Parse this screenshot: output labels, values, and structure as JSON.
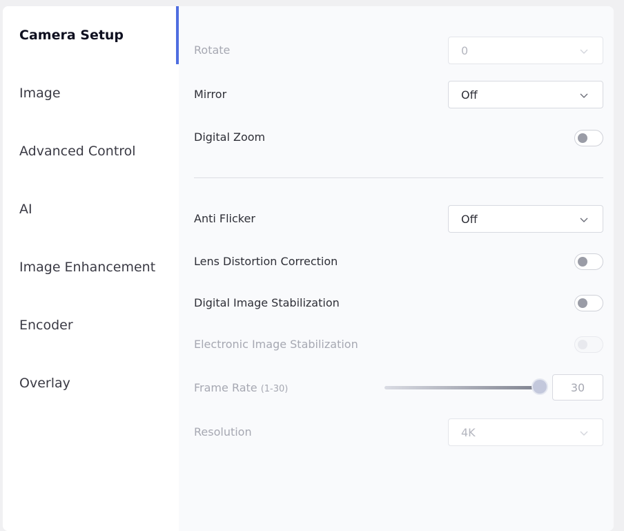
{
  "sidebar": {
    "items": [
      {
        "label": "Camera Setup",
        "active": true
      },
      {
        "label": "Image"
      },
      {
        "label": "Advanced Control"
      },
      {
        "label": "AI"
      },
      {
        "label": "Image Enhancement"
      },
      {
        "label": "Encoder"
      },
      {
        "label": "Overlay"
      }
    ],
    "accent_color": "#4f6ee0"
  },
  "settings": {
    "rotate": {
      "label": "Rotate",
      "value": "0",
      "disabled": true
    },
    "mirror": {
      "label": "Mirror",
      "value": "Off"
    },
    "digital_zoom": {
      "label": "Digital Zoom",
      "on": false
    },
    "anti_flicker": {
      "label": "Anti Flicker",
      "value": "Off"
    },
    "lens_distortion": {
      "label": "Lens Distortion Correction",
      "on": false
    },
    "dis": {
      "label": "Digital Image Stabilization",
      "on": false
    },
    "eis": {
      "label": "Electronic Image Stabilization",
      "on": false,
      "disabled": true
    },
    "frame_rate": {
      "label": "Frame Rate",
      "range": "(1-30)",
      "value": "30",
      "min": 1,
      "max": 30,
      "disabled": true
    },
    "resolution": {
      "label": "Resolution",
      "value": "4K",
      "disabled": true
    }
  },
  "icons": {
    "dropdown": "chevron-down-icon"
  }
}
